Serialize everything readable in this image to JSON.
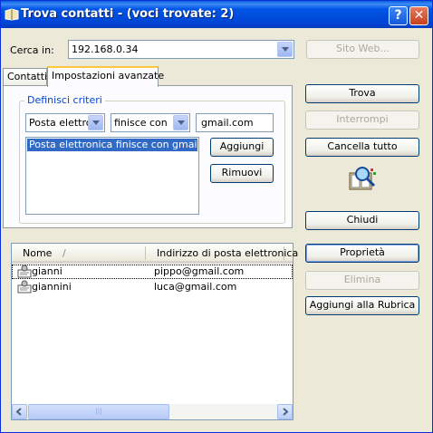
{
  "window": {
    "title": "Trova contatti - (voci trovate: 2)",
    "help_btn": "?",
    "close_btn": "✕"
  },
  "search_in": {
    "label": "Cerca in:",
    "label_mnemonic": "e",
    "value": "192.168.0.34",
    "website_button": "Sito Web..."
  },
  "tabs": [
    {
      "label": "Contatti",
      "active": false
    },
    {
      "label": "Impostazioni avanzate",
      "active": true
    }
  ],
  "criteria": {
    "group_title": "Definisci criteri",
    "field_select": "Posta elettroi",
    "condition_select": "finisce con",
    "value_input": "gmail.com",
    "list_items": [
      "Posta elettronica finisce con gmail.com"
    ],
    "add_button": "Aggiungi",
    "remove_button": "Rimuovi"
  },
  "actions": {
    "find": "Trova",
    "stop": "Interrompi",
    "clear_all": "Cancella tutto",
    "close": "Chiudi",
    "properties": "Proprietà",
    "delete": "Elimina",
    "add_to_addressbook": "Aggiungi alla Rubrica"
  },
  "results": {
    "columns": [
      "Nome",
      "Indirizzo di posta elettronica"
    ],
    "sort_indicator": "/",
    "rows": [
      {
        "name": "gianni",
        "email": "pippo@gmail.com"
      },
      {
        "name": "giannini",
        "email": "luca@gmail.com"
      }
    ],
    "scroll_thumb_grip": "|||"
  }
}
